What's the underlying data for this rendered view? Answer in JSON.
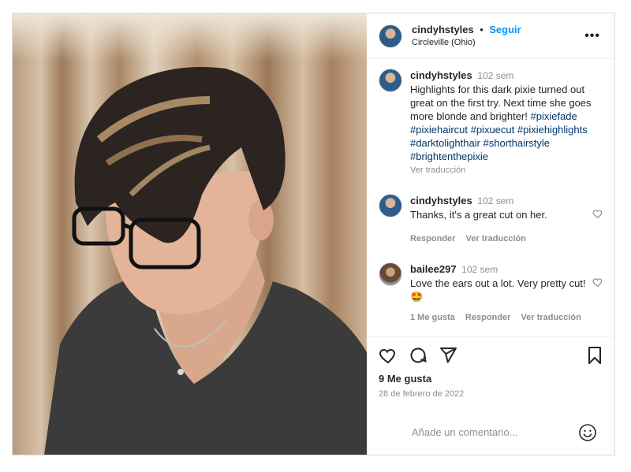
{
  "header": {
    "username": "cindyhstyles",
    "separator": "•",
    "follow_label": "Seguir",
    "location": "Circleville (Ohio)",
    "more_label": "•••"
  },
  "caption": {
    "username": "cindyhstyles",
    "time": "102 sem",
    "text": "Highlights for this dark pixie turned out great on the first try. Next time she goes more blonde and brighter!",
    "hashtags": "#pixiefade #pixiehaircut #pixuecut #pixiehighlights #darktolighthair #shorthairstyle #brightenthepixie",
    "translate": "Ver traducción"
  },
  "comments": [
    {
      "username": "cindyhstyles",
      "time": "102 sem",
      "text": "Thanks, it's a great cut on her.",
      "reply": "Responder",
      "translate": "Ver traducción"
    },
    {
      "username": "bailee297",
      "time": "102 sem",
      "text": "Love the ears out a lot. Very pretty cut! 🤩",
      "likes": "1 Me gusta",
      "reply": "Responder",
      "translate": "Ver traducción"
    }
  ],
  "stats": {
    "likes": "9 Me gusta",
    "date": "28 de febrero de 2022"
  },
  "add_comment": {
    "placeholder": "Añade un comentario..."
  },
  "icons": [
    "heart-icon",
    "comment-icon",
    "share-icon",
    "bookmark-icon",
    "emoji-icon",
    "more-icon"
  ]
}
